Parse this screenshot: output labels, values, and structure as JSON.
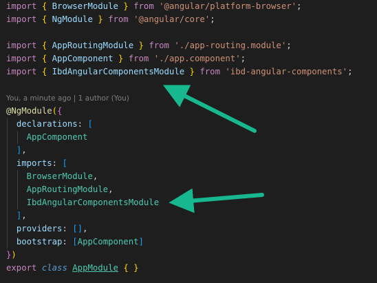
{
  "theme": {
    "background": "#1e1e1e",
    "keyword": "#c586c0",
    "storage": "#569cd6",
    "string": "#ce9178",
    "identifier": "#9cdcfe",
    "class": "#4ec9b0",
    "function": "#dcdcaa",
    "bracket_gold": "#ffd700",
    "bracket_orchid": "#da70d6",
    "bracket_blue": "#179fff",
    "codelens": "#7f7f7f",
    "arrow": "#17b890"
  },
  "codelens": "You, a minute ago | 1 author (You)",
  "lines": [
    [
      [
        "kw",
        "import"
      ],
      [
        "pl",
        " "
      ],
      [
        "br1",
        "{"
      ],
      [
        "pl",
        " "
      ],
      [
        "id",
        "BrowserModule"
      ],
      [
        "pl",
        " "
      ],
      [
        "br1",
        "}"
      ],
      [
        "pl",
        " "
      ],
      [
        "kw",
        "from"
      ],
      [
        "pl",
        " "
      ],
      [
        "str",
        "'@angular/platform-browser'"
      ],
      [
        "pl",
        ";"
      ]
    ],
    [
      [
        "kw",
        "import"
      ],
      [
        "pl",
        " "
      ],
      [
        "br1",
        "{"
      ],
      [
        "pl",
        " "
      ],
      [
        "id",
        "NgModule"
      ],
      [
        "pl",
        " "
      ],
      [
        "br1",
        "}"
      ],
      [
        "pl",
        " "
      ],
      [
        "kw",
        "from"
      ],
      [
        "pl",
        " "
      ],
      [
        "str",
        "'@angular/core'"
      ],
      [
        "pl",
        ";"
      ]
    ],
    [],
    [
      [
        "kw",
        "import"
      ],
      [
        "pl",
        " "
      ],
      [
        "br1",
        "{"
      ],
      [
        "pl",
        " "
      ],
      [
        "id",
        "AppRoutingModule"
      ],
      [
        "pl",
        " "
      ],
      [
        "br1",
        "}"
      ],
      [
        "pl",
        " "
      ],
      [
        "kw",
        "from"
      ],
      [
        "pl",
        " "
      ],
      [
        "str",
        "'./app-routing.module'"
      ],
      [
        "pl",
        ";"
      ]
    ],
    [
      [
        "kw",
        "import"
      ],
      [
        "pl",
        " "
      ],
      [
        "br1",
        "{"
      ],
      [
        "pl",
        " "
      ],
      [
        "id",
        "AppComponent"
      ],
      [
        "pl",
        " "
      ],
      [
        "br1",
        "}"
      ],
      [
        "pl",
        " "
      ],
      [
        "kw",
        "from"
      ],
      [
        "pl",
        " "
      ],
      [
        "str",
        "'./app.component'"
      ],
      [
        "pl",
        ";"
      ]
    ],
    [
      [
        "kw",
        "import"
      ],
      [
        "pl",
        " "
      ],
      [
        "br1",
        "{"
      ],
      [
        "pl",
        " "
      ],
      [
        "id",
        "IbdAngularComponentsModule"
      ],
      [
        "pl",
        " "
      ],
      [
        "br1",
        "}"
      ],
      [
        "pl",
        " "
      ],
      [
        "kw",
        "from"
      ],
      [
        "pl",
        " "
      ],
      [
        "str",
        "'ibd-angular-components'"
      ],
      [
        "pl",
        ";"
      ]
    ],
    [],
    [
      [
        "fn",
        "@NgModule"
      ],
      [
        "br1",
        "("
      ],
      [
        "br2",
        "{"
      ]
    ],
    [
      [
        "pl",
        "  "
      ],
      [
        "id",
        "declarations"
      ],
      [
        "pl",
        ": "
      ],
      [
        "br3",
        "["
      ]
    ],
    [
      [
        "pl",
        "    "
      ],
      [
        "cls",
        "AppComponent"
      ]
    ],
    [
      [
        "pl",
        "  "
      ],
      [
        "br3",
        "]"
      ],
      [
        "pl",
        ","
      ]
    ],
    [
      [
        "pl",
        "  "
      ],
      [
        "id",
        "imports"
      ],
      [
        "pl",
        ": "
      ],
      [
        "br3",
        "["
      ]
    ],
    [
      [
        "pl",
        "    "
      ],
      [
        "cls",
        "BrowserModule"
      ],
      [
        "pl",
        ","
      ]
    ],
    [
      [
        "pl",
        "    "
      ],
      [
        "cls",
        "AppRoutingModule"
      ],
      [
        "pl",
        ","
      ]
    ],
    [
      [
        "pl",
        "    "
      ],
      [
        "cls",
        "IbdAngularComponentsModule"
      ]
    ],
    [
      [
        "pl",
        "  "
      ],
      [
        "br3",
        "]"
      ],
      [
        "pl",
        ","
      ]
    ],
    [
      [
        "pl",
        "  "
      ],
      [
        "id",
        "providers"
      ],
      [
        "pl",
        ": "
      ],
      [
        "br3",
        "[]"
      ],
      [
        "pl",
        ","
      ]
    ],
    [
      [
        "pl",
        "  "
      ],
      [
        "id",
        "bootstrap"
      ],
      [
        "pl",
        ": "
      ],
      [
        "br3",
        "["
      ],
      [
        "cls",
        "AppComponent"
      ],
      [
        "br3",
        "]"
      ]
    ],
    [
      [
        "br2",
        "}"
      ],
      [
        "br1",
        ")"
      ]
    ],
    [
      [
        "kw",
        "export"
      ],
      [
        "pl",
        " "
      ],
      [
        "kwb ital",
        "class"
      ],
      [
        "pl",
        " "
      ],
      [
        "cls ul",
        "AppModule"
      ],
      [
        "pl",
        " "
      ],
      [
        "br1",
        "{"
      ],
      [
        "pl",
        " "
      ],
      [
        "br1",
        "}"
      ]
    ]
  ]
}
